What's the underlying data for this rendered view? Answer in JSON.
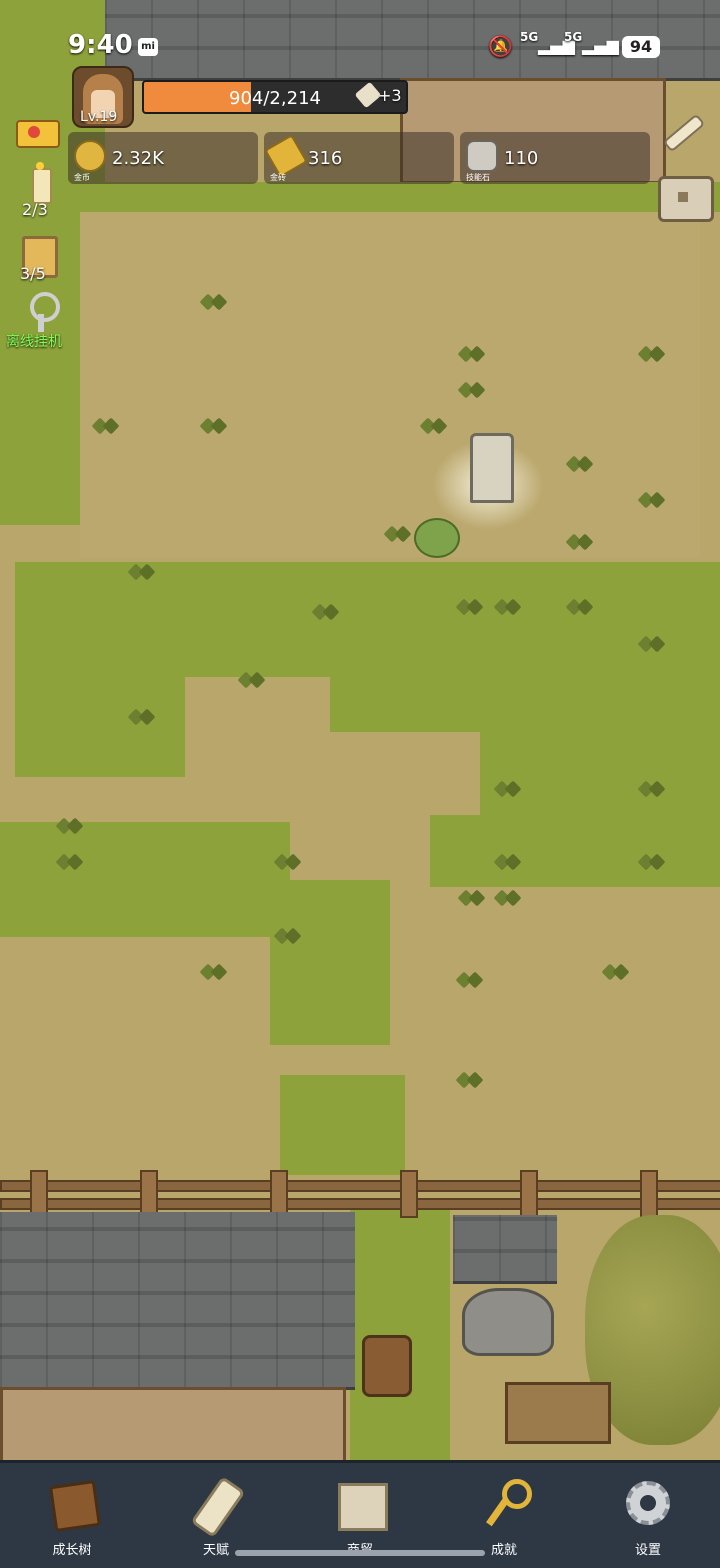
{
  "status_bar": {
    "time": "9:40",
    "carrier_badge": "mi",
    "signal_1": "5G",
    "signal_2": "5G",
    "battery": "94"
  },
  "player": {
    "level": "Lv.19",
    "xp_text": "904/2,214",
    "xp_fraction": 0.408,
    "xp_bonus": "+3"
  },
  "resources": [
    {
      "label": "金币",
      "value": "2.32K",
      "icon": "gold-coin-icon"
    },
    {
      "label": "金砖",
      "value": "316",
      "icon": "gold-bar-icon"
    },
    {
      "label": "技能石",
      "value": "110",
      "icon": "skill-stone-icon"
    }
  ],
  "side": {
    "candle_count": "2/3",
    "beer_count": "3/5",
    "idle_label": "离线挂机"
  },
  "nav": [
    {
      "label": "成长树",
      "icon": "book-icon"
    },
    {
      "label": "天赋",
      "icon": "scroll-icon"
    },
    {
      "label": "商贸",
      "icon": "map-icon"
    },
    {
      "label": "成就",
      "icon": "key-icon"
    },
    {
      "label": "设置",
      "icon": "gear-icon"
    }
  ],
  "colors": {
    "xp_fill": "#f08a3d",
    "grass": "#8ea23b",
    "dirt": "#bba86e",
    "idle_text": "#7dff55",
    "nav_bg": "#2e3844"
  }
}
